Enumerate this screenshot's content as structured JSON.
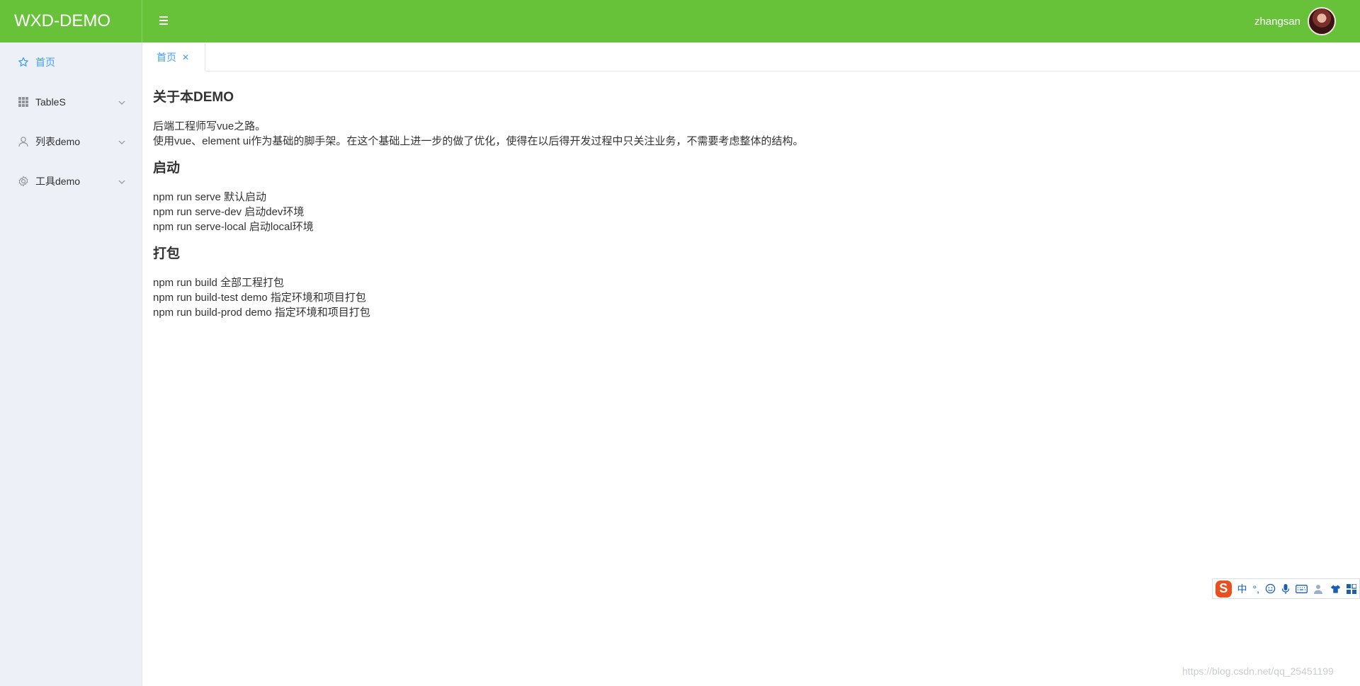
{
  "header": {
    "logo": "WXD-DEMO",
    "username": "zhangsan",
    "toggle_icon": "hamburger-icon",
    "brand_color": "#67c23a"
  },
  "sidebar": {
    "items": [
      {
        "label": "首页",
        "icon": "star-icon",
        "active": true
      },
      {
        "label": "TableS",
        "icon": "grid-icon",
        "expandable": true
      },
      {
        "label": "列表demo",
        "icon": "user-icon",
        "expandable": true
      },
      {
        "label": "工具demo",
        "icon": "gear-icon",
        "expandable": true
      }
    ]
  },
  "tabs": [
    {
      "label": "首页",
      "closable": true
    }
  ],
  "content": {
    "sections": [
      {
        "heading": "关于本DEMO",
        "lines": [
          "后端工程师写vue之路。",
          "使用vue、element ui作为基础的脚手架。在这个基础上进一步的做了优化，使得在以后得开发过程中只关注业务，不需要考虑整体的结构。"
        ]
      },
      {
        "heading": "启动",
        "lines": [
          "npm run serve 默认启动",
          "npm run serve-dev 启动dev环境",
          "npm run serve-local 启动local环境"
        ]
      },
      {
        "heading": "打包",
        "lines": [
          "npm run build 全部工程打包",
          "npm run build-test demo 指定环境和项目打包",
          "npm run build-prod demo 指定环境和项目打包"
        ]
      }
    ]
  },
  "ime": {
    "logo": "S",
    "mode": "中",
    "punct": "°,"
  },
  "watermark": "https://blog.csdn.net/qq_25451199",
  "colors": {
    "active": "#409eff",
    "sidebar_bg": "#edf1f7"
  }
}
